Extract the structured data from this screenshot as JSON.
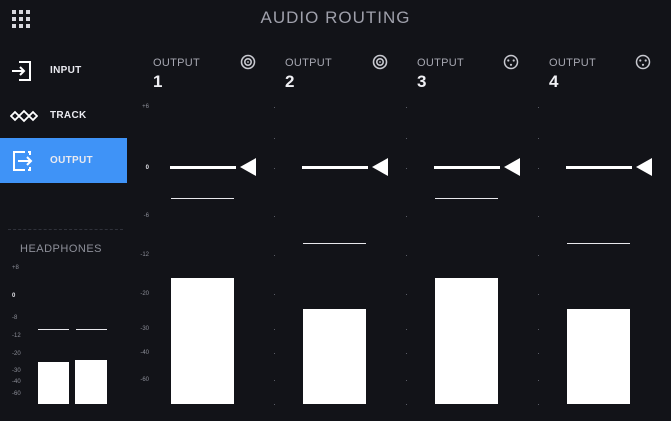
{
  "header": {
    "title": "AUDIO ROUTING",
    "menu_icon": "grid-menu-icon"
  },
  "sidebar": {
    "items": [
      {
        "label": "INPUT",
        "icon": "input-arrow-icon",
        "active": false
      },
      {
        "label": "TRACK",
        "icon": "track-waveform-icon",
        "active": false
      },
      {
        "label": "OUTPUT",
        "icon": "output-arrow-icon",
        "active": true
      }
    ],
    "accent_color": "#3f93f7"
  },
  "headphones": {
    "title": "HEADPHONES",
    "scale": [
      "+8",
      "0",
      "-8",
      "-12",
      "-20",
      "-30",
      "-40",
      "-60"
    ]
  },
  "channel_scale": [
    "+6",
    "0",
    "-6",
    "-12",
    "-20",
    "-30",
    "-40",
    "-60"
  ],
  "outputs": [
    {
      "label": "OUTPUT",
      "number": "1",
      "icon": "speaker-icon"
    },
    {
      "label": "OUTPUT",
      "number": "2",
      "icon": "speaker-icon"
    },
    {
      "label": "OUTPUT",
      "number": "3",
      "icon": "xlr-connector-icon"
    },
    {
      "label": "OUTPUT",
      "number": "4",
      "icon": "xlr-connector-icon"
    }
  ]
}
